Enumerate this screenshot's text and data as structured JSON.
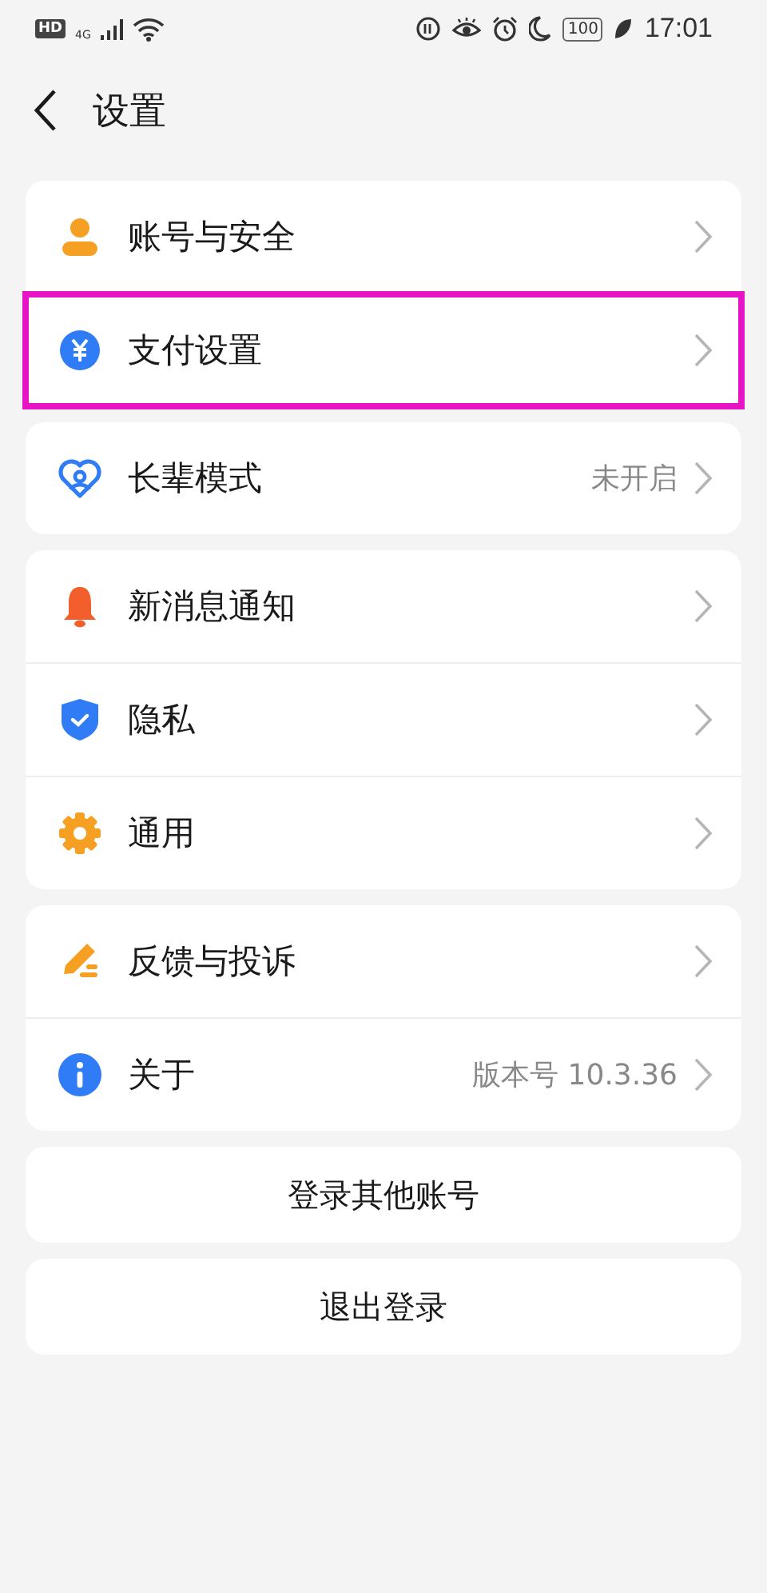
{
  "status_bar": {
    "hd": "HD",
    "network": "4G",
    "battery": "100",
    "time": "17:01"
  },
  "header": {
    "title": "设置"
  },
  "groups": [
    {
      "items": [
        {
          "kind": "person",
          "label": "账号与安全",
          "highlighted": false
        },
        {
          "kind": "yuan",
          "label": "支付设置",
          "highlighted": true
        }
      ]
    },
    {
      "items": [
        {
          "kind": "heart",
          "label": "长辈模式",
          "value": "未开启",
          "highlighted": false
        }
      ]
    },
    {
      "items": [
        {
          "kind": "bell",
          "label": "新消息通知",
          "highlighted": false
        },
        {
          "kind": "shield",
          "label": "隐私",
          "highlighted": false
        },
        {
          "kind": "gear",
          "label": "通用",
          "highlighted": false
        }
      ]
    },
    {
      "items": [
        {
          "kind": "pencil",
          "label": "反馈与投诉",
          "highlighted": false
        },
        {
          "kind": "info",
          "label": "关于",
          "value": "版本号 10.3.36",
          "highlighted": false
        }
      ]
    }
  ],
  "buttons": [
    "登录其他账号",
    "退出登录"
  ]
}
